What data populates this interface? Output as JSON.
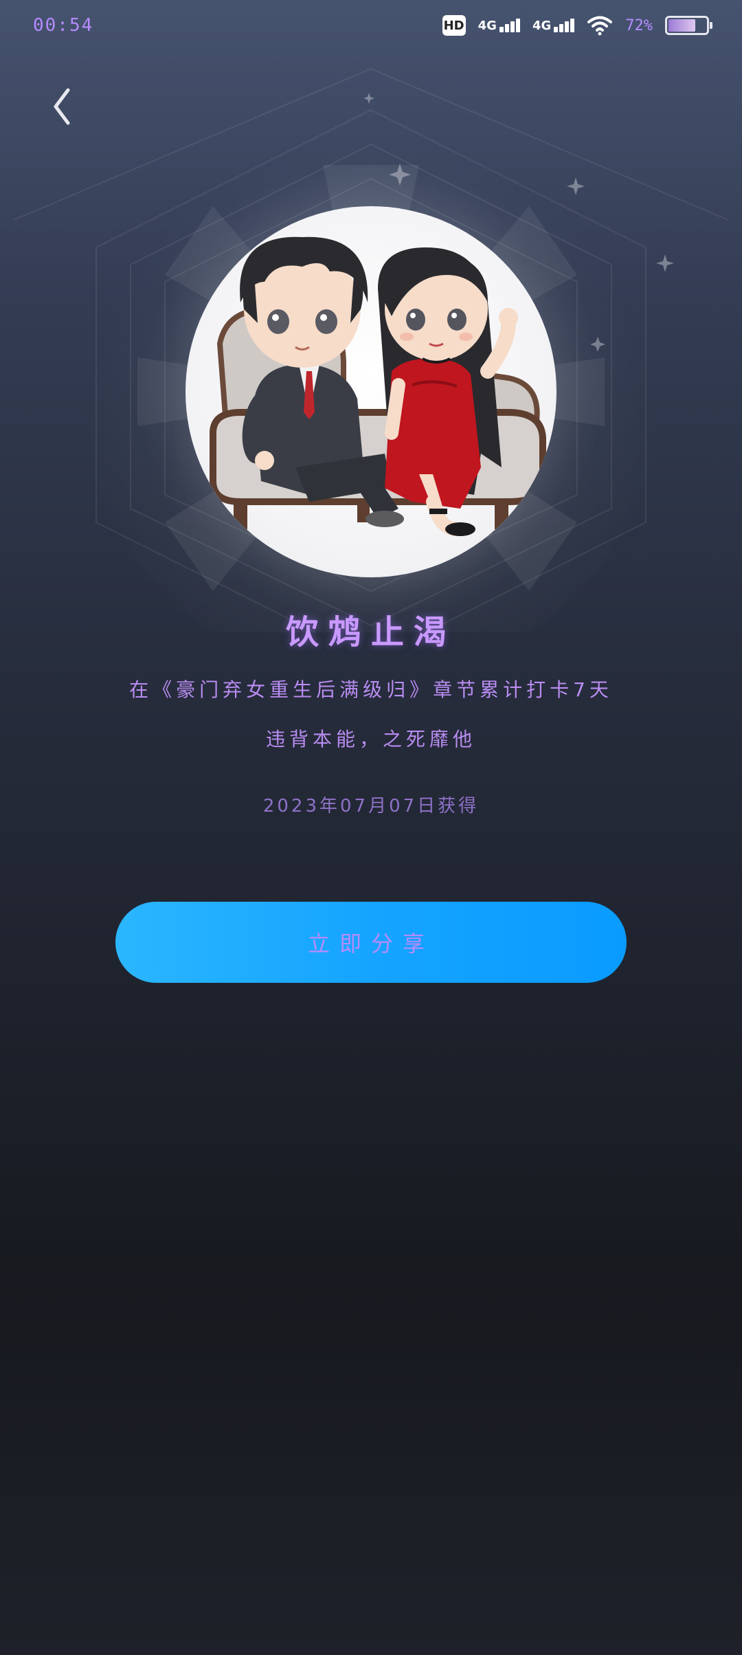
{
  "status_bar": {
    "time": "00:54",
    "hd_label": "HD",
    "network_1": "4G",
    "network_2": "4G",
    "battery_percent_text": "72%",
    "battery_level": 0.72
  },
  "header": {
    "back_icon": "chevron-left-icon"
  },
  "badge": {
    "avatar_icon": "couple-illustration",
    "title": "饮鸩止渴",
    "description_line1": "在《豪门弃女重生后满级归》章节累计打卡7天",
    "description_line2": "违背本能，之死靡他",
    "date": "2023年07月07日获得"
  },
  "actions": {
    "share_label": "立即分享"
  },
  "colors": {
    "accent_text": "#b58cff",
    "button_gradient_start": "#2bb6ff",
    "button_gradient_end": "#0a9bff"
  }
}
